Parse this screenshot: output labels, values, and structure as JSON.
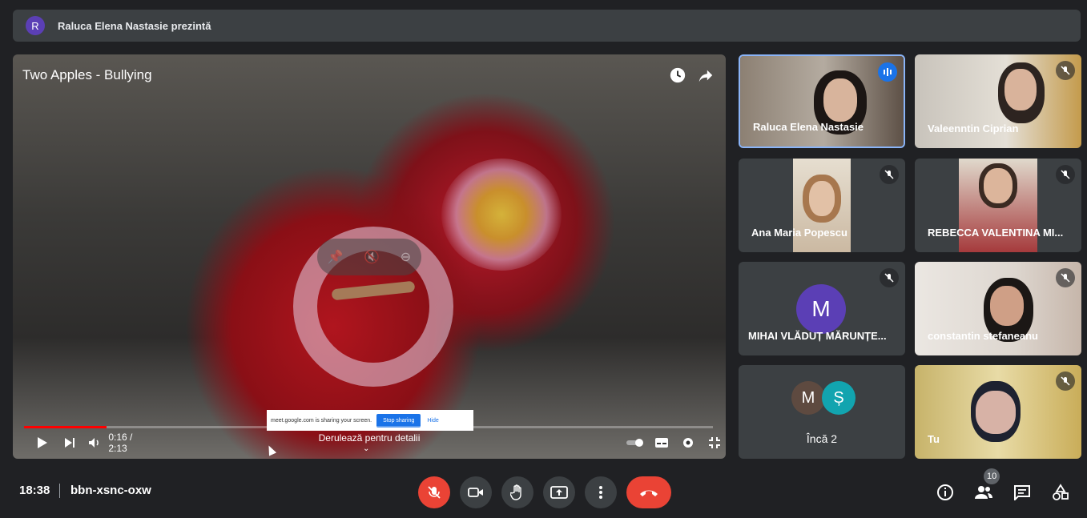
{
  "header": {
    "avatar_letter": "R",
    "presenting_text": "Raluca Elena Nastasie prezintă"
  },
  "presentation": {
    "video_title": "Two Apples - Bullying",
    "time": "0:16 / 2:13",
    "progress": 0.12,
    "scroll_hint": "Derulează pentru detalii",
    "share_banner": {
      "text": "meet.google.com is sharing your screen.",
      "stop": "Stop sharing",
      "hide": "Hide"
    }
  },
  "participants": [
    {
      "name": "Raluca Elena Nastasie",
      "speaking": true
    },
    {
      "name": "Valeenntin Ciprian",
      "muted": true
    },
    {
      "name": "Ana Maria Popescu",
      "muted": true
    },
    {
      "name": "REBECCA VALENTINA MI...",
      "muted": true
    },
    {
      "name": "MIHAI VLĂDUȚ MĂRUNȚE...",
      "avatar_letter": "M",
      "muted": true
    },
    {
      "name": "constantin stefaneanu",
      "muted": true
    },
    {
      "name": "Încă 2",
      "avatars": [
        "M",
        "Ș"
      ]
    },
    {
      "name": "Tu",
      "muted": true
    }
  ],
  "footer": {
    "time": "18:38",
    "meeting_code": "bbn-xsnc-oxw",
    "participant_count": "10"
  },
  "colors": {
    "accent": "#1a73e8",
    "danger": "#ea4335",
    "surface": "#3c4043",
    "background": "#202124"
  }
}
